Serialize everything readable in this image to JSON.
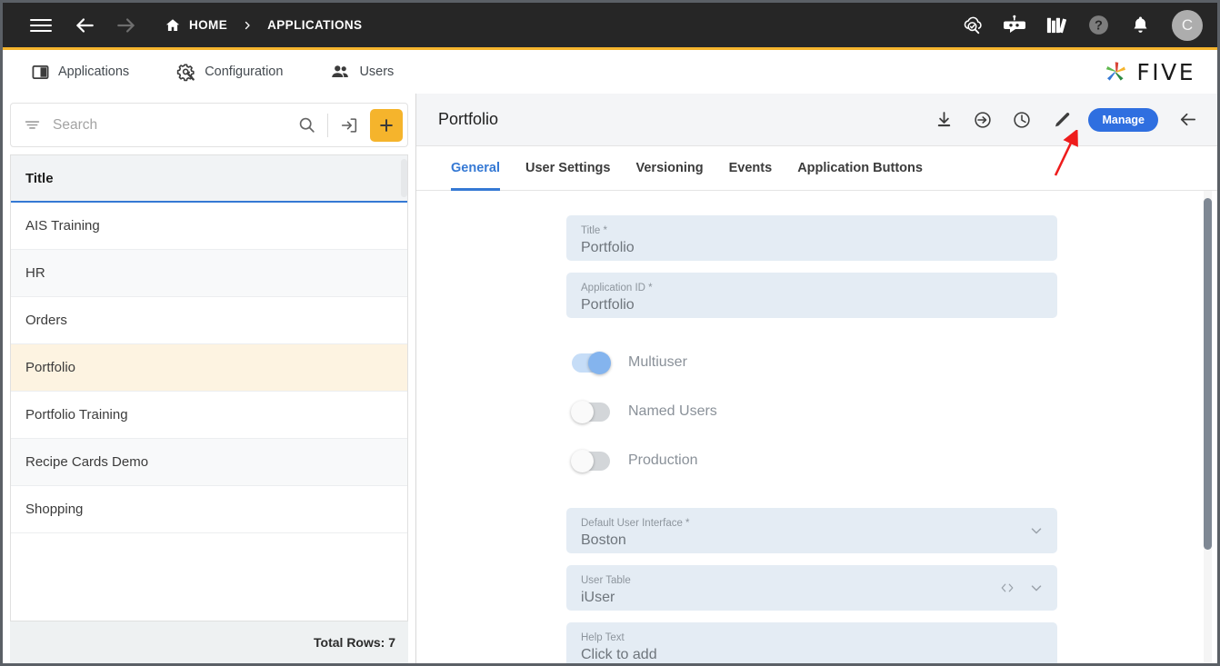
{
  "topbar": {
    "menu_icon": "hamburger-icon",
    "back_icon": "arrow-left-icon",
    "forward_icon": "arrow-right-icon",
    "home_label": "HOME",
    "separator": "›",
    "current_label": "APPLICATIONS",
    "actions": [
      {
        "name": "cloud-search-icon",
        "label": "Cloud Search"
      },
      {
        "name": "chatbot-icon",
        "label": "Chatbot"
      },
      {
        "name": "books-icon",
        "label": "Documentation"
      },
      {
        "name": "help-icon",
        "label": "Help"
      },
      {
        "name": "notifications-icon",
        "label": "Notifications"
      }
    ],
    "avatar_initial": "C",
    "accent_color": "#f5b42c"
  },
  "navbar": {
    "items": [
      {
        "label": "Applications",
        "icon": "applications-icon"
      },
      {
        "label": "Configuration",
        "icon": "gear-wrench-icon"
      },
      {
        "label": "Users",
        "icon": "users-icon"
      }
    ],
    "logo_text": "FIVE"
  },
  "sidebar": {
    "search": {
      "placeholder": "Search",
      "value": ""
    },
    "filter_icon": "filter-icon",
    "search_icon": "search-icon",
    "export_icon": "export-icon",
    "add_label": "+",
    "column_header": "Title",
    "rows": [
      {
        "title": "AIS Training",
        "selected": false
      },
      {
        "title": "HR",
        "selected": false
      },
      {
        "title": "Orders",
        "selected": false
      },
      {
        "title": "Portfolio",
        "selected": true
      },
      {
        "title": "Portfolio Training",
        "selected": false
      },
      {
        "title": "Recipe Cards Demo",
        "selected": false
      },
      {
        "title": "Shopping",
        "selected": false
      }
    ],
    "total_rows_label": "Total Rows: 7",
    "selected_color": "#fdf3e1",
    "header_underline_color": "#3579d4"
  },
  "detail": {
    "title": "Portfolio",
    "header_actions": [
      {
        "name": "download-icon",
        "label": "Download"
      },
      {
        "name": "deploy-icon",
        "label": "Deploy"
      },
      {
        "name": "history-icon",
        "label": "History"
      },
      {
        "name": "edit-pencil-icon",
        "label": "Edit"
      }
    ],
    "manage_label": "Manage",
    "manage_color": "#2f6fe0",
    "back_icon": "arrow-left-icon",
    "tabs": [
      {
        "label": "General",
        "active": true
      },
      {
        "label": "User Settings",
        "active": false
      },
      {
        "label": "Versioning",
        "active": false
      },
      {
        "label": "Events",
        "active": false
      },
      {
        "label": "Application Buttons",
        "active": false
      }
    ],
    "fields": [
      {
        "label": "Title *",
        "value": "Portfolio",
        "icons": []
      },
      {
        "label": "Application ID *",
        "value": "Portfolio",
        "icons": []
      }
    ],
    "toggles": [
      {
        "label": "Multiuser",
        "on": true
      },
      {
        "label": "Named Users",
        "on": false
      },
      {
        "label": "Production",
        "on": false
      }
    ],
    "fields_lower": [
      {
        "label": "Default User Interface *",
        "value": "Boston",
        "icons": [
          "chevron-down-icon"
        ]
      },
      {
        "label": "User Table",
        "value": "iUser",
        "icons": [
          "code-brackets-icon",
          "chevron-down-icon"
        ]
      },
      {
        "label": "Help Text",
        "value": "Click to add",
        "icons": []
      }
    ],
    "annotation": {
      "type": "red-arrow",
      "points_at": "edit-pencil-icon",
      "color": "#ee1c1c"
    }
  }
}
